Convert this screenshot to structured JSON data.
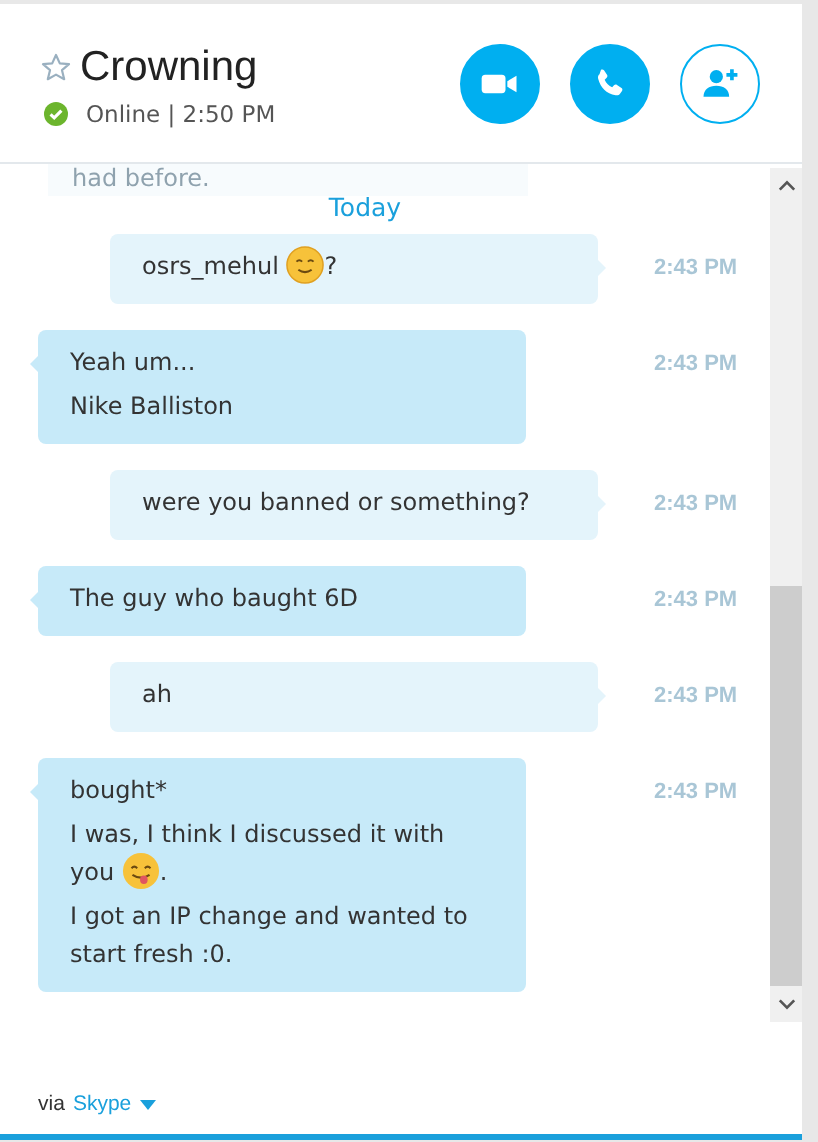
{
  "contact": {
    "name": "Crowning",
    "favorite": false,
    "status": "Online",
    "separator": "|",
    "time": "2:50 PM",
    "online": true
  },
  "actions": [
    {
      "kind": "video",
      "filled": true
    },
    {
      "kind": "call",
      "filled": true
    },
    {
      "kind": "add",
      "filled": false
    }
  ],
  "previous_message": "had before.",
  "day_divider": "Today",
  "messages": [
    {
      "kind": "sent",
      "time": "2:43 PM",
      "paragraphs": [
        [
          {
            "kind": "text",
            "text": "osrs_mehul "
          },
          {
            "kind": "smile"
          },
          {
            "kind": "text",
            "text": "?"
          }
        ]
      ]
    },
    {
      "kind": "received",
      "time": "2:43 PM",
      "paragraphs": [
        [
          {
            "kind": "text",
            "text": "Yeah um..."
          }
        ],
        [
          {
            "kind": "text",
            "text": "Nike Balliston"
          }
        ]
      ]
    },
    {
      "kind": "sent",
      "time": "2:43 PM",
      "paragraphs": [
        [
          {
            "kind": "text",
            "text": "were you banned or something?"
          }
        ]
      ]
    },
    {
      "kind": "received",
      "time": "2:43 PM",
      "paragraphs": [
        [
          {
            "kind": "text",
            "text": "The guy who baught 6D"
          }
        ]
      ]
    },
    {
      "kind": "sent",
      "time": "2:43 PM",
      "paragraphs": [
        [
          {
            "kind": "text",
            "text": "ah"
          }
        ]
      ]
    },
    {
      "kind": "received",
      "time": "2:43 PM",
      "paragraphs": [
        [
          {
            "kind": "text",
            "text": "bought*"
          }
        ],
        [
          {
            "kind": "text",
            "text": "I was, I think I discussed it with you "
          },
          {
            "kind": "tongue"
          },
          {
            "kind": "text",
            "text": "."
          }
        ],
        [
          {
            "kind": "text",
            "text": "I got an IP change and wanted to start fresh :0."
          }
        ]
      ]
    }
  ],
  "footer": {
    "prefix": "via",
    "service": "Skype"
  }
}
